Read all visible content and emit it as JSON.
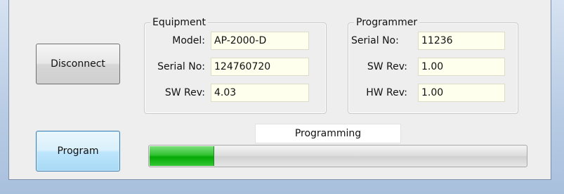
{
  "buttons": {
    "disconnect": "Disconnect",
    "program": "Program"
  },
  "equipment": {
    "title": "Equipment",
    "model_label": "Model:",
    "model_value": "AP-2000-D",
    "serial_label": "Serial No:",
    "serial_value": "124760720",
    "swrev_label": "SW Rev:",
    "swrev_value": "4.03"
  },
  "programmer": {
    "title": "Programmer",
    "serial_label": "Serial No:",
    "serial_value": "11236",
    "swrev_label": "SW Rev:",
    "swrev_value": "1.00",
    "hwrev_label": "HW Rev:",
    "hwrev_value": "1.00"
  },
  "status": {
    "text": "Programming",
    "progress": 0.17
  },
  "colors": {
    "field_background": "#ffffee",
    "progress_green": "#06a906",
    "primary_button": "#bee6fd"
  }
}
